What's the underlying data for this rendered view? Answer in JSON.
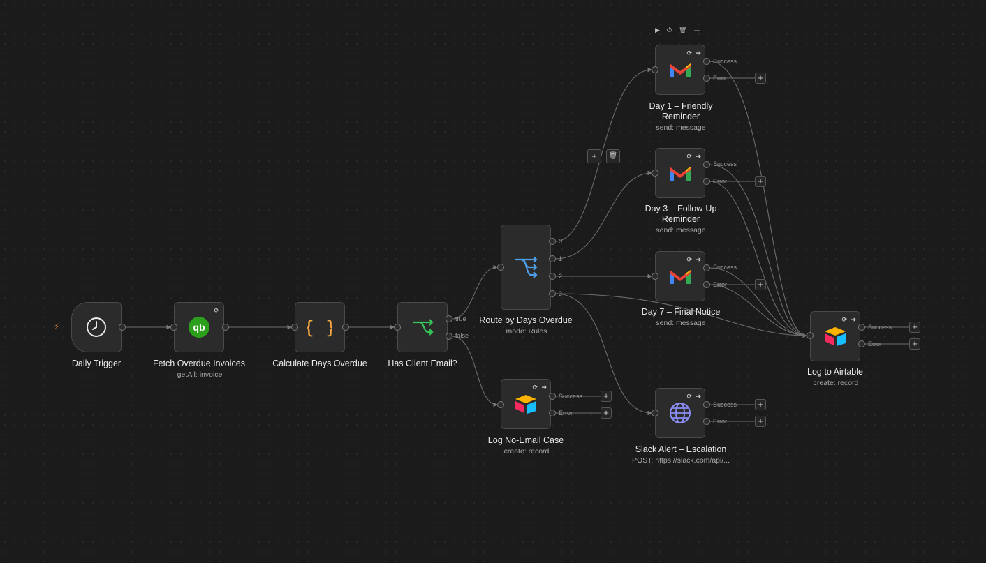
{
  "nodes": [
    {
      "id": "trigger",
      "title": "Daily Trigger",
      "subtitle": "",
      "icon": "clock-icon"
    },
    {
      "id": "fetch",
      "title": "Fetch Overdue Invoices",
      "subtitle": "getAll: invoice",
      "icon": "quickbooks-icon"
    },
    {
      "id": "calc",
      "title": "Calculate Days Overdue",
      "subtitle": "",
      "icon": "code-braces-icon"
    },
    {
      "id": "has_email",
      "title": "Has Client Email?",
      "subtitle": "",
      "icon": "branch-icon"
    },
    {
      "id": "route",
      "title": "Route by Days Overdue",
      "subtitle": "mode: Rules",
      "icon": "switch-icon"
    },
    {
      "id": "no_email",
      "title": "Log No-Email Case",
      "subtitle": "create: record",
      "icon": "airtable-icon"
    },
    {
      "id": "day1",
      "title": "Day 1 – Friendly Reminder",
      "subtitle": "send: message",
      "icon": "gmail-icon"
    },
    {
      "id": "day3",
      "title": "Day 3 – Follow-Up Reminder",
      "subtitle": "send: message",
      "icon": "gmail-icon"
    },
    {
      "id": "day7",
      "title": "Day 7 – Final Notice",
      "subtitle": "send: message",
      "icon": "gmail-icon"
    },
    {
      "id": "slack",
      "title": "Slack Alert – Escalation",
      "subtitle": "POST: https://slack.com/api/...",
      "icon": "globe-icon"
    },
    {
      "id": "log",
      "title": "Log to Airtable",
      "subtitle": "create: record",
      "icon": "airtable-icon"
    }
  ],
  "port_labels": {
    "if_true": "true",
    "if_false": "false",
    "route_0": "0",
    "route_1": "1",
    "route_2": "2",
    "route_3": "3",
    "success": "Success",
    "error": "Error"
  },
  "toolbar": {
    "play": "▶",
    "power": "⏻",
    "delete": "🗑",
    "more": "···"
  },
  "edge_toolbar": {
    "add": "+",
    "delete": "🗑"
  },
  "mini_icons": {
    "retry": "⟳",
    "arrow": "➔"
  },
  "plus_label": "+",
  "trigger_marker": "⚡",
  "colors": {
    "canvas": "#1b1b1b",
    "node": "#2b2b2b",
    "edge": "#6d6d6d",
    "if_green": "#35c35a",
    "code_orange": "#f4a742",
    "switch_blue": "#4f9ee8",
    "globe_purple": "#8b8cf5",
    "qb_green": "#2ca01c"
  }
}
